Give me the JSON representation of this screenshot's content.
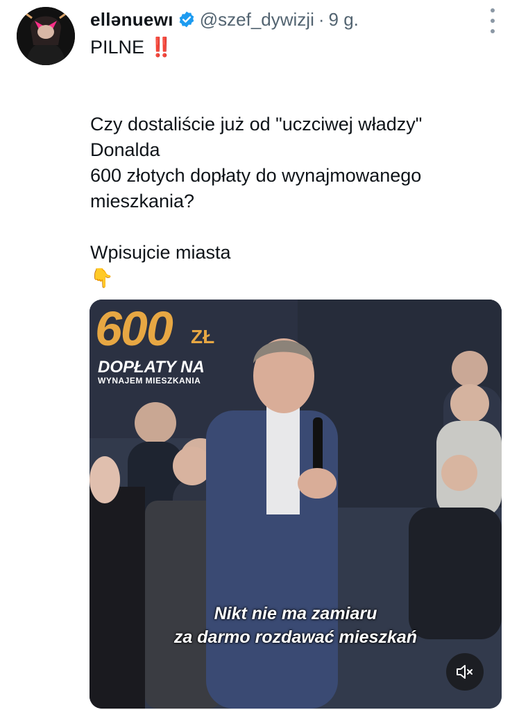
{
  "tweet": {
    "author": {
      "display_name": "ellənuewı",
      "handle": "@szef_dywizji",
      "verified": true
    },
    "separator": "·",
    "time": "9 g.",
    "text_lines": [
      "PILNE ‼️",
      "",
      "Czy dostaliście już od \"uczciwej władzy\"",
      "Donalda",
      "600 złotych dopłaty do wynajmowanego",
      "mieszkania?",
      "",
      "Wpisujcie miasta",
      "👇"
    ]
  },
  "video": {
    "overlay_amount": "600",
    "overlay_currency": "ZŁ",
    "overlay_headline": "DOPŁATY NA",
    "overlay_subheadline": "WYNAJEM MIESZKANIA",
    "subtitle_line1": "Nikt nie ma zamiaru",
    "subtitle_line2": "za darmo rozdawać mieszkań",
    "mute_state": "muted"
  },
  "colors": {
    "verified_badge": "#1d9bf0",
    "overlay_accent": "#e7a743",
    "secondary_text": "#536471"
  },
  "icons": [
    "verified-badge-icon",
    "more-options-icon",
    "speaker-muted-icon",
    "down-pointing-hand-emoji"
  ]
}
